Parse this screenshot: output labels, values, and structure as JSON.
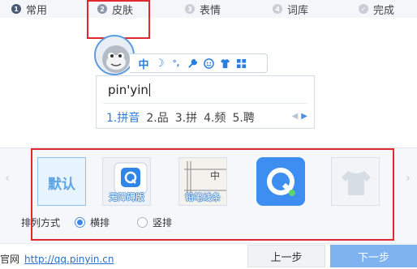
{
  "steps": [
    {
      "num": "1",
      "label": "常用"
    },
    {
      "num": "2",
      "label": "皮肤"
    },
    {
      "num": "3",
      "label": "表情"
    },
    {
      "num": "4",
      "label": "词库"
    },
    {
      "num": "✓",
      "label": "完成"
    }
  ],
  "preview": {
    "toolbar_items": [
      "中",
      "☽",
      "°,",
      "wrench-icon",
      "smiley-icon",
      "shirt-icon",
      "grid-icon"
    ],
    "pinyin_text": "pin'yin",
    "candidates": [
      "1.拼音",
      "2.品",
      "3.拼",
      "4.频",
      "5.聘"
    ]
  },
  "skins": {
    "items": [
      {
        "name": "默认",
        "label": ""
      },
      {
        "name": "无障碍版",
        "label": "无障碍版"
      },
      {
        "name": "铅笔线条",
        "label": "铅笔线条"
      },
      {
        "name": "Q",
        "label": ""
      },
      {
        "name": "shirt",
        "label": ""
      }
    ],
    "default_text": "默认"
  },
  "arrange": {
    "label": "排列方式",
    "options": [
      "横排",
      "竖排"
    ],
    "selected": "横排"
  },
  "footer": {
    "site_prefix": "官网",
    "site_url": "http://qq.pinyin.cn",
    "prev_label": "上一步",
    "next_label": "下一步"
  },
  "colors": {
    "accent": "#3d86e6",
    "annotation": "#e0282e",
    "next_button": "#7fb3ef"
  }
}
